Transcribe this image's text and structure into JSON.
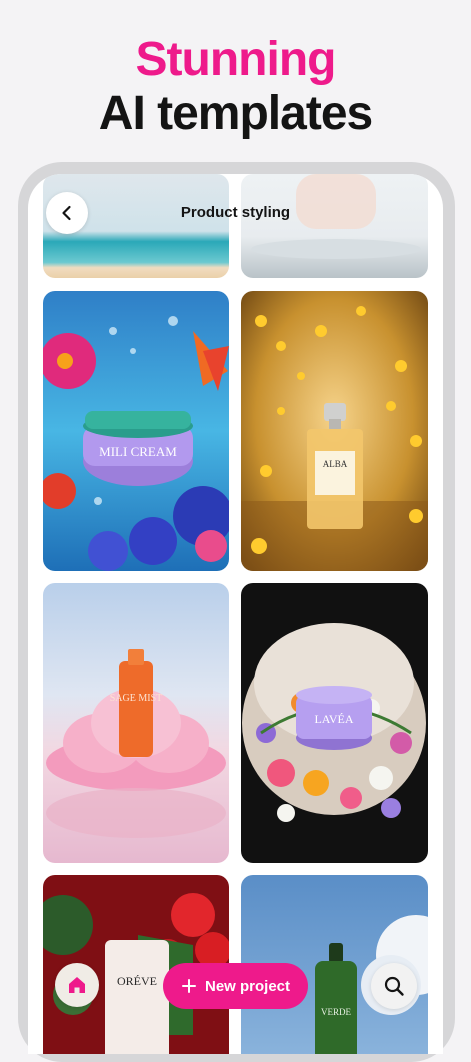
{
  "headline": {
    "line1": "Stunning",
    "line2": "AI templates"
  },
  "screen": {
    "title": "Product styling"
  },
  "products": [
    {
      "brand": "MILI CREAM"
    },
    {
      "brand": "ALBA"
    },
    {
      "brand": "SAGE MIST"
    },
    {
      "brand": "LAVÉA"
    },
    {
      "brand": "ORÉVE"
    },
    {
      "brand": "VERDE"
    }
  ],
  "bottom_bar": {
    "new_project_label": "New project"
  },
  "icons": {
    "back": "chevron-left-icon",
    "home": "home-icon",
    "add": "plus-icon",
    "search": "search-icon"
  },
  "colors": {
    "accent": "#ee1a8b",
    "text": "#141414"
  }
}
